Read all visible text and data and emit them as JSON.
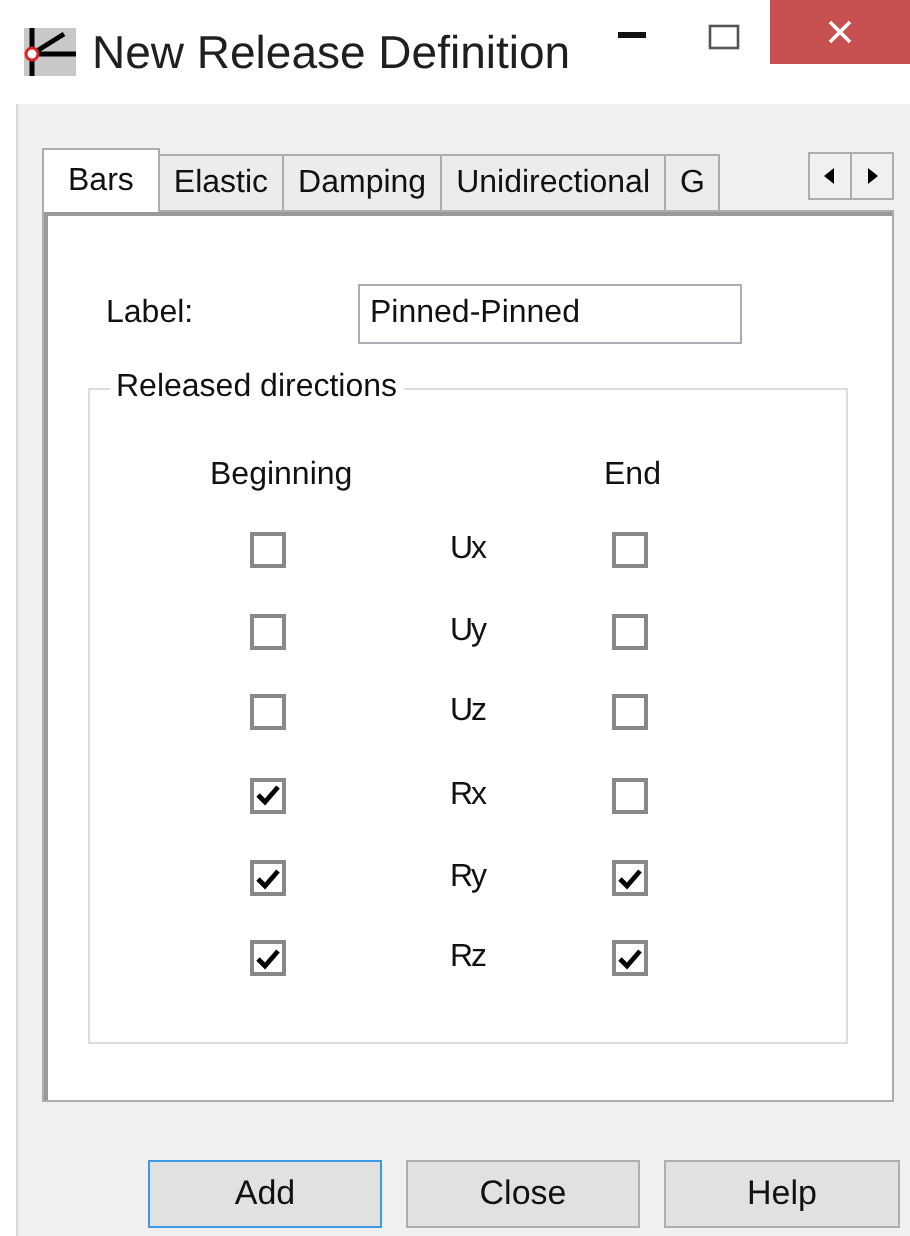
{
  "window": {
    "title": "New Release Definition"
  },
  "tabs": [
    {
      "label": "Bars",
      "selected": true
    },
    {
      "label": "Elastic",
      "selected": false
    },
    {
      "label": "Damping",
      "selected": false
    },
    {
      "label": "Unidirectional",
      "selected": false
    },
    {
      "label": "G",
      "selected": false
    }
  ],
  "label_field": {
    "label": "Label:",
    "value": "Pinned-Pinned"
  },
  "group": {
    "title": "Released directions",
    "column_1": "Beginning",
    "column_2": "End",
    "rows": [
      {
        "name": "Ux",
        "beginning": false,
        "end": false
      },
      {
        "name": "Uy",
        "beginning": false,
        "end": false
      },
      {
        "name": "Uz",
        "beginning": false,
        "end": false
      },
      {
        "name": "Rx",
        "beginning": true,
        "end": false
      },
      {
        "name": "Ry",
        "beginning": true,
        "end": true
      },
      {
        "name": "Rz",
        "beginning": true,
        "end": true
      }
    ]
  },
  "buttons": [
    {
      "label": "Add",
      "focused": true
    },
    {
      "label": "Close",
      "focused": false
    },
    {
      "label": "Help",
      "focused": false
    }
  ]
}
